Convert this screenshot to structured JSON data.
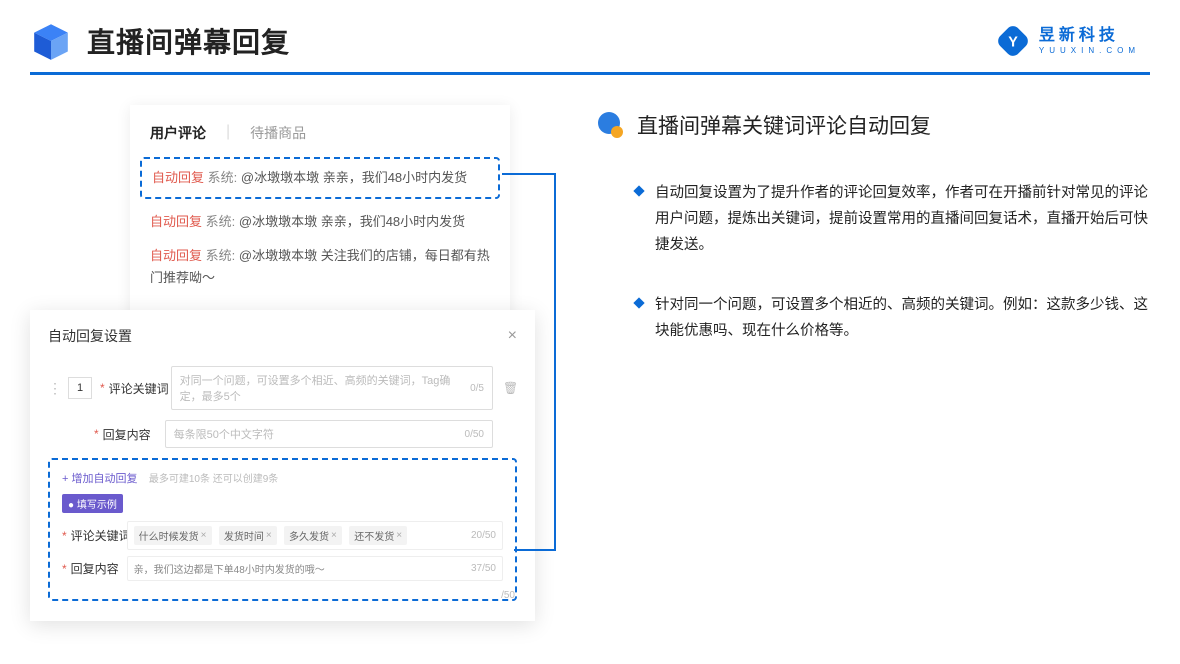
{
  "header": {
    "title": "直播间弹幕回复",
    "brand_cn": "昱新科技",
    "brand_en": "YUUXIN.COM"
  },
  "comments": {
    "tab_active": "用户评论",
    "tab_inactive": "待播商品",
    "rows": [
      {
        "tag": "自动回复",
        "sys": "系统:",
        "text": "@冰墩墩本墩 亲亲，我们48小时内发货"
      },
      {
        "tag": "自动回复",
        "sys": "系统:",
        "text": "@冰墩墩本墩 亲亲，我们48小时内发货"
      },
      {
        "tag": "自动回复",
        "sys": "系统:",
        "text": "@冰墩墩本墩 关注我们的店铺，每日都有热门推荐呦～"
      }
    ]
  },
  "settings": {
    "title": "自动回复设置",
    "num": "1",
    "kw_label": "评论关键词",
    "kw_placeholder": "对同一个问题，可设置多个相近、高频的关键词，Tag确定，最多5个",
    "kw_counter": "0/5",
    "content_label": "回复内容",
    "content_placeholder": "每条限50个中文字符",
    "content_counter": "0/50",
    "add_link": "+ 增加自动回复",
    "hint": "最多可建10条 还可以创建9条",
    "example_badge": "● 填写示例",
    "ex_kw_label": "评论关键词",
    "ex_tags": [
      "什么时候发货",
      "发货时间",
      "多久发货",
      "还不发货"
    ],
    "ex_kw_counter": "20/50",
    "ex_content_label": "回复内容",
    "ex_content_value": "亲，我们这边都是下单48小时内发货的哦～",
    "ex_content_counter": "37/50",
    "stray_counter": "/50"
  },
  "right": {
    "section_title": "直播间弹幕关键词评论自动回复",
    "bullets": [
      "自动回复设置为了提升作者的评论回复效率，作者可在开播前针对常见的评论用户问题，提炼出关键词，提前设置常用的直播间回复话术，直播开始后可快捷发送。",
      "针对同一个问题，可设置多个相近的、高频的关键词。例如：这款多少钱、这块能优惠吗、现在什么价格等。"
    ]
  }
}
